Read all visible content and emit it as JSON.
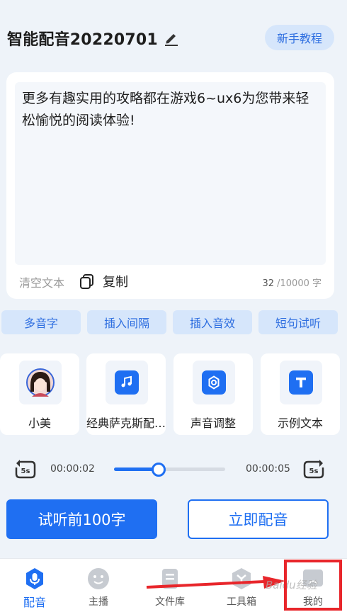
{
  "header": {
    "title": "智能配音20220701",
    "guide_button": "新手教程"
  },
  "editor": {
    "text": "更多有趣实用的攻略都在游戏6~ux6为您带来轻松愉悦的阅读体验!",
    "clear_label": "清空文本",
    "copy_label": "复制",
    "count": "32",
    "limit": "/10000 字"
  },
  "chips": [
    "多音字",
    "插入间隔",
    "插入音效",
    "短句试听"
  ],
  "cards": [
    {
      "label": "小美",
      "icon": "avatar-icon"
    },
    {
      "label": "经典萨克斯配…",
      "icon": "music-note-icon"
    },
    {
      "label": "声音调整",
      "icon": "settings-gear-icon"
    },
    {
      "label": "示例文本",
      "icon": "text-t-icon"
    }
  ],
  "player": {
    "current_time": "00:00:02",
    "total_time": "00:00:05",
    "skip_label": "5s",
    "progress": 0.4
  },
  "actions": {
    "preview": "试听前100字",
    "dub_now": "立即配音"
  },
  "tabbar": {
    "items": [
      {
        "label": "配音",
        "icon": "microphone-icon",
        "active": true
      },
      {
        "label": "主播",
        "icon": "smiley-icon",
        "active": false
      },
      {
        "label": "文件库",
        "icon": "file-icon",
        "active": false
      },
      {
        "label": "工具箱",
        "icon": "toolbox-icon",
        "active": false
      },
      {
        "label": "我的",
        "icon": "profile-icon",
        "active": false
      }
    ]
  },
  "overlay": {
    "watermark": "Baidu经验"
  },
  "colors": {
    "accent": "#1f6ff2",
    "chip_bg": "#d6e6fb",
    "highlight": "#e8262b"
  }
}
